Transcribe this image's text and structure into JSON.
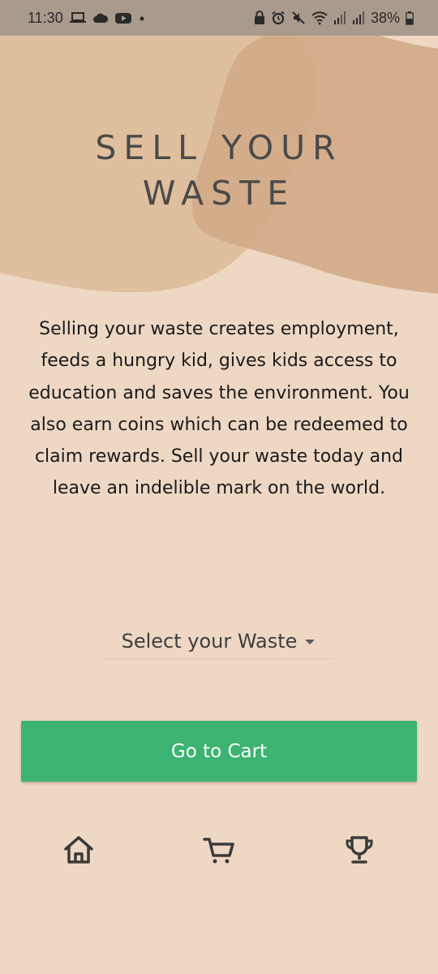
{
  "status_bar": {
    "time": "11:30",
    "battery": "38%",
    "left_icons": [
      "laptop-icon",
      "cloud-icon",
      "youtube-icon",
      "dot-icon"
    ],
    "right_icons": [
      "lock-icon",
      "alarm-icon",
      "mute-icon",
      "wifi-icon",
      "signal-icon",
      "signal-icon",
      "battery-icon"
    ]
  },
  "header": {
    "title_line1": "SELL YOUR",
    "title_line2": "WASTE"
  },
  "description": "Selling your waste creates employment, feeds a hungry kid, gives kids access to education and saves the environment. You also earn coins which can be redeemed to claim rewards. Sell your waste today and leave an indelible mark on the world.",
  "waste_select": {
    "placeholder": "Select your Waste"
  },
  "cart_button": {
    "label": "Go to Cart"
  },
  "bottom_nav": {
    "items": [
      {
        "icon": "home-icon"
      },
      {
        "icon": "cart-icon"
      },
      {
        "icon": "trophy-icon"
      }
    ]
  },
  "colors": {
    "background": "#EED8C4",
    "accent": "#3CB371",
    "blob_light": "#DFBF9E",
    "blob_dark": "#D2AB87",
    "status_bar": "#A89A8C"
  }
}
